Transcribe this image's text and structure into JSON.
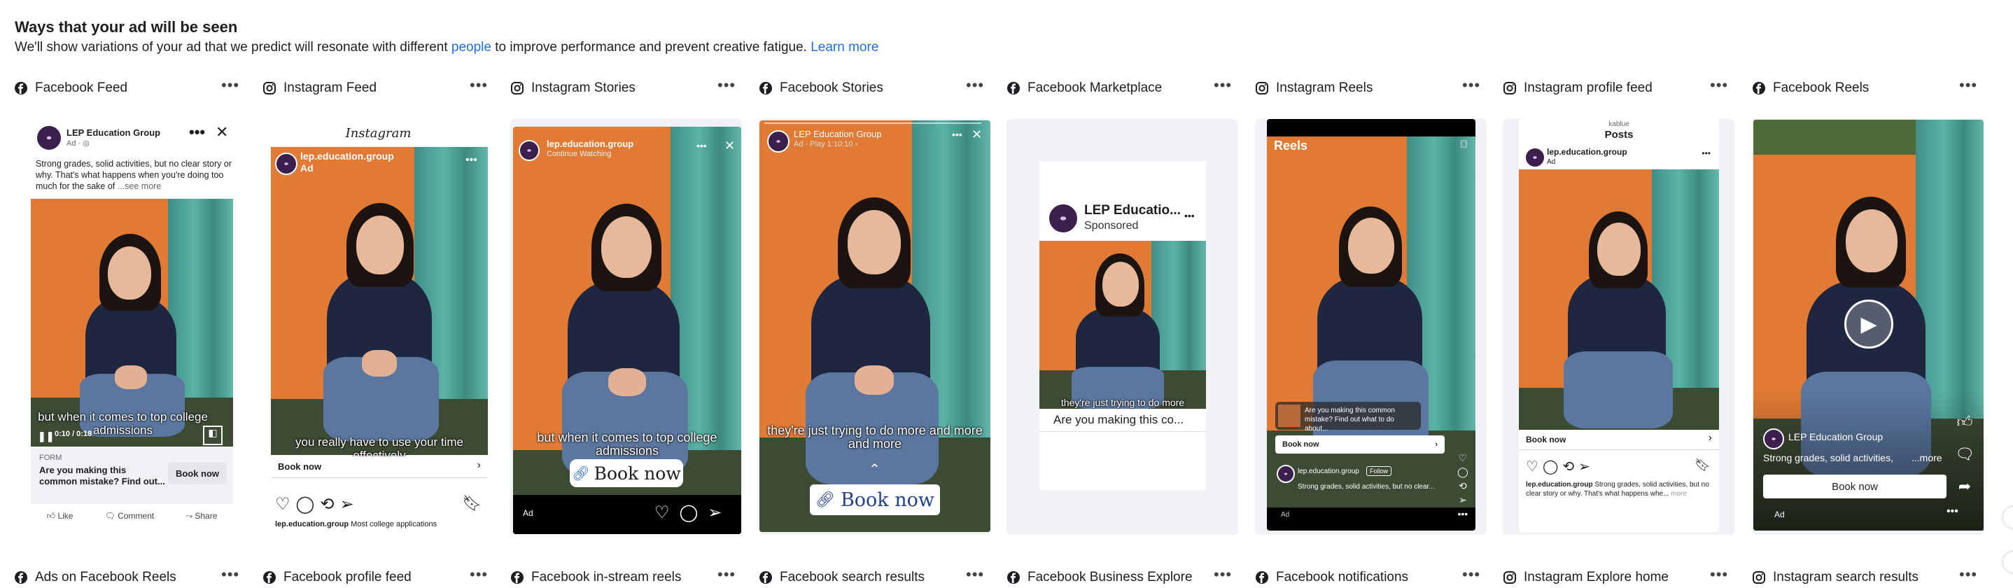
{
  "header": {
    "title": "Ways that your ad will be seen",
    "desc_before": "We'll show variations of your ad that we predict will resonate with different ",
    "desc_link": "people",
    "desc_after": " to improve performance and prevent creative fatigue. ",
    "learn_more": "Learn more"
  },
  "placements": [
    {
      "name": "Facebook Feed",
      "icon": "facebook-icon"
    },
    {
      "name": "Instagram Feed",
      "icon": "instagram-icon"
    },
    {
      "name": "Instagram Stories",
      "icon": "instagram-icon"
    },
    {
      "name": "Facebook Stories",
      "icon": "facebook-icon"
    },
    {
      "name": "Facebook Marketplace",
      "icon": "facebook-icon"
    },
    {
      "name": "Instagram Reels",
      "icon": "instagram-icon"
    },
    {
      "name": "Instagram profile feed",
      "icon": "instagram-icon"
    },
    {
      "name": "Facebook Reels",
      "icon": "facebook-icon"
    }
  ],
  "placements_row2": [
    {
      "name": "Ads on Facebook Reels",
      "icon": "facebook-icon"
    },
    {
      "name": "Facebook profile feed",
      "icon": "facebook-icon"
    },
    {
      "name": "Facebook in-stream reels",
      "icon": "facebook-icon"
    },
    {
      "name": "Facebook search results",
      "icon": "facebook-icon"
    },
    {
      "name": "Facebook Business Explore",
      "icon": "facebook-icon"
    },
    {
      "name": "Facebook notifications",
      "icon": "facebook-icon"
    },
    {
      "name": "Instagram Explore home",
      "icon": "instagram-icon"
    },
    {
      "name": "Instagram search results",
      "icon": "instagram-icon"
    }
  ],
  "more": "•••",
  "fb_feed": {
    "page": "LEP Education Group",
    "sub": "Ad · ",
    "text": "Strong grades, solid activities, but no clear story or why. That's what happens when you're doing too much for the sake of",
    "see_more": "...see more",
    "caption": "but when it comes to top college admissions",
    "time": "0:10 / 0:18",
    "cta_label": "FORM",
    "cta_text": "Are you making this common mistake? Find out...",
    "cta_button": "Book now",
    "like": "Like",
    "comment": "Comment",
    "share": "Share"
  },
  "ig_feed": {
    "logo": "Instagram",
    "handle": "lep.education.group",
    "ad": "Ad",
    "caption": "you really have to use your time effectively",
    "cta": "Book now",
    "footer_handle": "lep.education.group",
    "footer_text": " Most college applications"
  },
  "ig_stories": {
    "handle": "lep.education.group",
    "sub": "Continue Watching",
    "caption": "but when it comes to top college admissions",
    "cta": "Book now",
    "ad": "Ad"
  },
  "fb_stories": {
    "page": "LEP Education Group",
    "sub": "Ad · Play 1:10:10 ›",
    "caption": "they're just trying to do more and more and more",
    "cta": "Book now"
  },
  "fb_marketplace": {
    "page": "LEP Educatio...",
    "sub": "Sponsored",
    "caption": "they're just trying to do more",
    "title": "Are you making this co..."
  },
  "ig_reels": {
    "title": "Reels",
    "promo_text": "Are you making this common mistake? Find out what to do about...",
    "cta": "Book now",
    "handle": "lep.education.group",
    "follow": "Follow",
    "text": "Strong grades, solid activities, but no clear...",
    "ad": "Ad"
  },
  "ig_profile": {
    "username": "kablue",
    "title": "Posts",
    "handle": "lep.education.group",
    "ad": "Ad",
    "cta": "Book now",
    "footer_handle": "lep.education.group",
    "footer_text": " Strong grades, solid activities, but no clear story or why. That's what happens whe...",
    "footer_more": " more"
  },
  "fb_reels": {
    "page": "LEP Education Group",
    "text": "Strong grades, solid activities,",
    "more": "...more",
    "cta": "Book now",
    "ad": "Ad"
  }
}
